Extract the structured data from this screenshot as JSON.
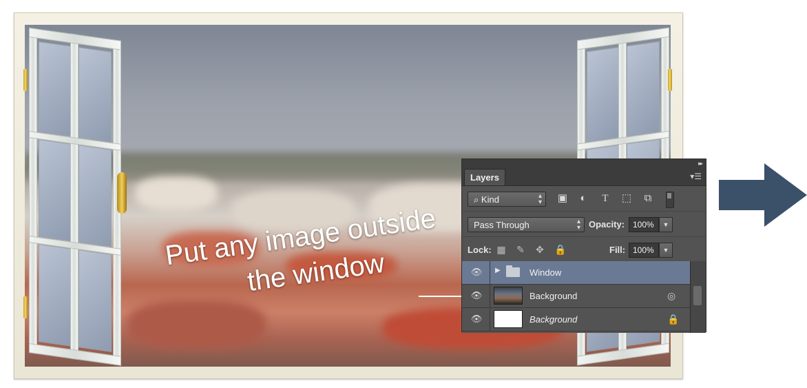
{
  "scene": {
    "headline_line1": "Put any image outside",
    "headline_line2": "the window"
  },
  "colors": {
    "arrow_fill": "#3b5069",
    "panel_bg": "#535353",
    "selected_layer": "#6b7a94"
  },
  "panel": {
    "tab_label": "Layers",
    "menu_icon": "panel-menu-icon",
    "kind": {
      "search_icon": "⌕",
      "value": "Kind"
    },
    "filter_icons": [
      "image-filter-icon",
      "adjustment-filter-icon",
      "type-filter-icon",
      "shape-filter-icon",
      "smart-object-filter-icon"
    ],
    "blend_mode": "Pass Through",
    "opacity_label": "Opacity:",
    "opacity_value": "100%",
    "lock_label": "Lock:",
    "lock_icons": [
      "lock-transparent-icon",
      "lock-image-icon",
      "lock-position-icon",
      "lock-all-icon"
    ],
    "fill_label": "Fill:",
    "fill_value": "100%"
  },
  "layers": [
    {
      "name": "Window",
      "type": "group",
      "selected": true
    },
    {
      "name": "Background",
      "type": "smart-object",
      "selected": false
    },
    {
      "name": "Background",
      "type": "locked",
      "selected": false
    }
  ]
}
